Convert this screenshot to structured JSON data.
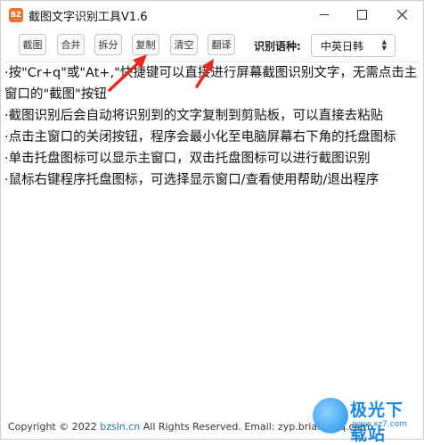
{
  "window": {
    "title": "截图文字识别工具V1.6",
    "app_icon_text": "BZ"
  },
  "toolbar": {
    "buttons": [
      "截图",
      "合并",
      "拆分",
      "复制",
      "清空",
      "翻译"
    ],
    "lang_label": "识别语种:",
    "lang_value": "中英日韩"
  },
  "content": {
    "lines": [
      "·按\"Cr+q\"或\"At+,\"快捷键可以直接进行屏幕截图识别文字，无需点击主窗口的\"截图\"按钮",
      "·截图识别后会自动将识别到的文字复制到剪贴板，可以直接去粘贴",
      "·点击主窗口的关闭按钮，程序会最小化至电脑屏幕右下角的托盘图标",
      "·单击托盘图标可以显示主窗口，双击托盘图标可以进行截图识别",
      "·鼠标右键程序托盘图标，可选择显示窗口/查看使用帮助/退出程序"
    ]
  },
  "footer": {
    "copyright": "Copyright © 2022",
    "site": "bzsln.cn",
    "rights": "All Rights Reserved.",
    "email": "Email: zyp.brian@qq.com"
  },
  "watermark": {
    "name": "极光下载站",
    "url": "www.xz7.com"
  },
  "colors": {
    "arrow": "#e02a22",
    "link": "#1a6fc7",
    "watermark": "#1b86df"
  }
}
